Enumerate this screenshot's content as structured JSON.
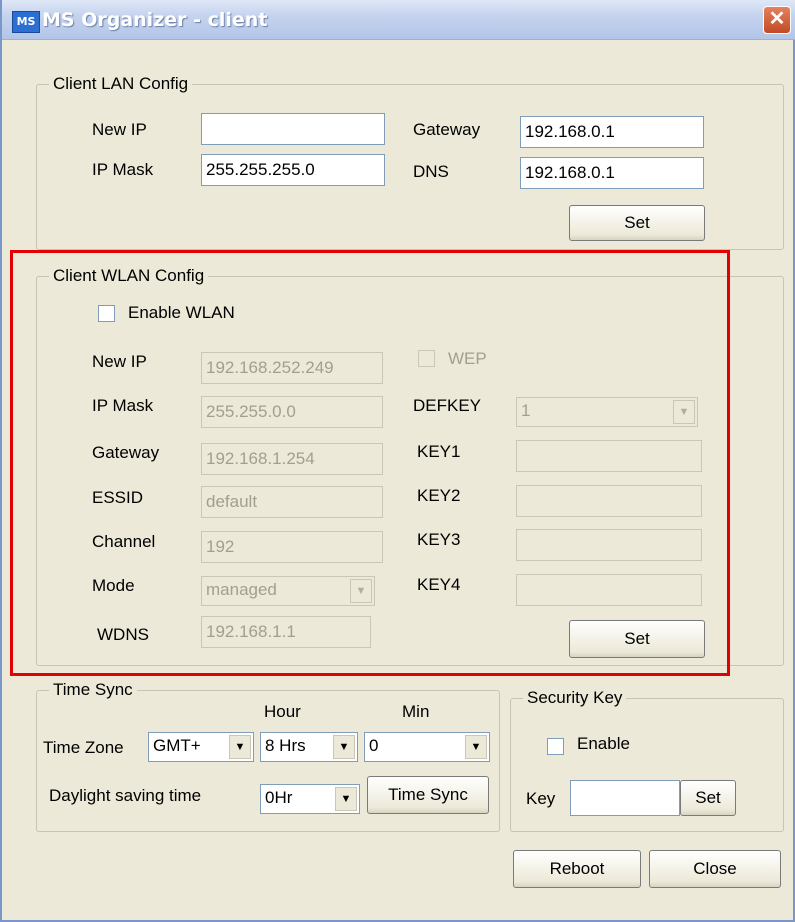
{
  "window": {
    "title": "MS Organizer - client",
    "icon": "ms-app-icon",
    "close_glyph": "✕"
  },
  "lan": {
    "legend": "Client LAN Config",
    "new_ip_label": "New IP",
    "new_ip_value": "",
    "ip_mask_label": "IP Mask",
    "ip_mask_value": "255.255.255.0",
    "gateway_label": "Gateway",
    "gateway_value": "192.168.0.1",
    "dns_label": "DNS",
    "dns_value": "192.168.0.1",
    "set_label": "Set"
  },
  "wlan": {
    "legend": "Client WLAN Config",
    "enable_label": "Enable WLAN",
    "enable_checked": false,
    "new_ip_label": "New IP",
    "new_ip_value": "192.168.252.249",
    "ip_mask_label": "IP Mask",
    "ip_mask_value": "255.255.0.0",
    "gateway_label": "Gateway",
    "gateway_value": "192.168.1.254",
    "essid_label": "ESSID",
    "essid_value": "default",
    "channel_label": "Channel",
    "channel_value": "192",
    "mode_label": "Mode",
    "mode_value": "managed",
    "wdns_label": "WDNS",
    "wdns_value": "192.168.1.1",
    "wep_label": "WEP",
    "defkey_label": "DEFKEY",
    "defkey_value": "1",
    "key1_label": "KEY1",
    "key1_value": "",
    "key2_label": "KEY2",
    "key2_value": "",
    "key3_label": "KEY3",
    "key3_value": "",
    "key4_label": "KEY4",
    "key4_value": "",
    "set_label": "Set"
  },
  "timesync": {
    "legend": "Time Sync",
    "hour_header": "Hour",
    "min_header": "Min",
    "timezone_label": "Time Zone",
    "timezone_value": "GMT+",
    "hour_value": "8 Hrs",
    "min_value": "0",
    "dst_label": "Daylight saving time",
    "dst_value": "0Hr",
    "sync_button": "Time Sync"
  },
  "security": {
    "legend": "Security Key",
    "enable_label": "Enable",
    "enable_checked": false,
    "key_label": "Key",
    "key_value": "",
    "set_label": "Set"
  },
  "footer": {
    "reboot_label": "Reboot",
    "close_label": "Close"
  },
  "highlight_color": "#e30000"
}
